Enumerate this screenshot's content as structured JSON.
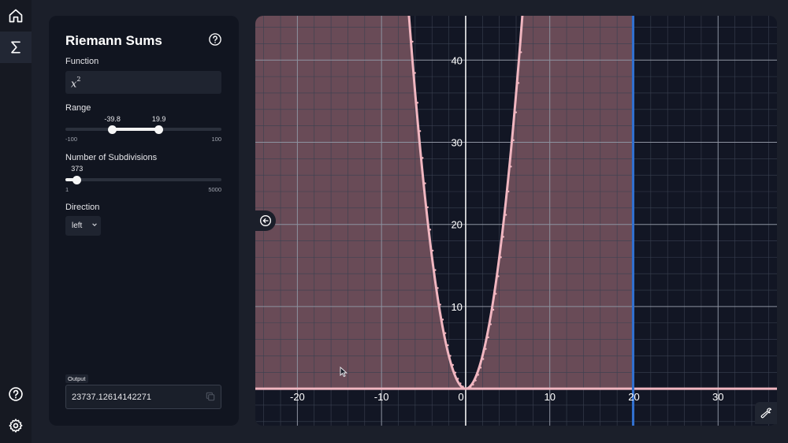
{
  "rail": {
    "items": [
      {
        "name": "home-icon",
        "active": false
      },
      {
        "name": "sigma-icon",
        "active": true
      }
    ],
    "bottom": [
      "help-icon",
      "gear-icon"
    ]
  },
  "panel": {
    "title": "Riemann Sums",
    "function_label": "Function",
    "function_base": "x",
    "function_exponent": "2",
    "range": {
      "label": "Range",
      "low": -39.8,
      "high": 19.9,
      "low_label": "-39.8",
      "high_label": "19.9",
      "min": -100,
      "max": 100,
      "min_label": "-100",
      "max_label": "100"
    },
    "subdivisions": {
      "label": "Number of Subdivisions",
      "value": 373,
      "value_label": "373",
      "min": 1,
      "max": 5000,
      "min_label": "1",
      "max_label": "5000"
    },
    "direction": {
      "label": "Direction",
      "value": "left"
    },
    "output": {
      "label": "Output",
      "value": "23737.12614142271"
    }
  },
  "graph": {
    "x_range": [
      -25,
      37
    ],
    "y_range": [
      -4.5,
      45.4
    ],
    "x_ticks": [
      "-20",
      "-10",
      "0",
      "10",
      "20",
      "30"
    ],
    "y_ticks": [
      "10",
      "20",
      "30",
      "40"
    ],
    "function": "x^2",
    "sum_from": -39.8,
    "sum_to": 19.9,
    "colors": {
      "background": "#121624",
      "grid_minor": "#3a4150",
      "grid_major": "#8d93a0",
      "curve": "#f1b6c0",
      "fill": "#8a5f6b",
      "boundary": "#2f6fd0"
    }
  }
}
